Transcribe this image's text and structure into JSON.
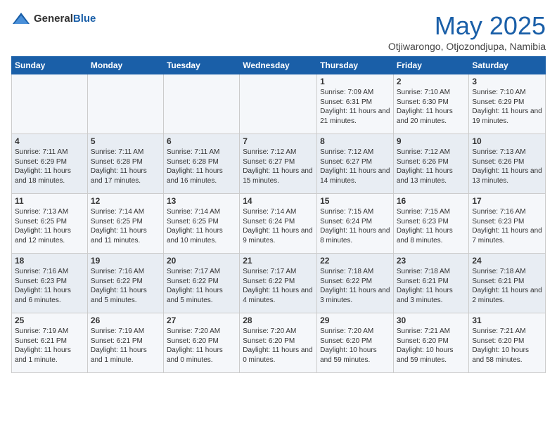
{
  "header": {
    "logo_general": "General",
    "logo_blue": "Blue",
    "month_title": "May 2025",
    "location": "Otjiwarongo, Otjozondjupa, Namibia"
  },
  "weekdays": [
    "Sunday",
    "Monday",
    "Tuesday",
    "Wednesday",
    "Thursday",
    "Friday",
    "Saturday"
  ],
  "weeks": [
    [
      {
        "day": "",
        "info": ""
      },
      {
        "day": "",
        "info": ""
      },
      {
        "day": "",
        "info": ""
      },
      {
        "day": "",
        "info": ""
      },
      {
        "day": "1",
        "info": "Sunrise: 7:09 AM\nSunset: 6:31 PM\nDaylight: 11 hours and 21 minutes."
      },
      {
        "day": "2",
        "info": "Sunrise: 7:10 AM\nSunset: 6:30 PM\nDaylight: 11 hours and 20 minutes."
      },
      {
        "day": "3",
        "info": "Sunrise: 7:10 AM\nSunset: 6:29 PM\nDaylight: 11 hours and 19 minutes."
      }
    ],
    [
      {
        "day": "4",
        "info": "Sunrise: 7:11 AM\nSunset: 6:29 PM\nDaylight: 11 hours and 18 minutes."
      },
      {
        "day": "5",
        "info": "Sunrise: 7:11 AM\nSunset: 6:28 PM\nDaylight: 11 hours and 17 minutes."
      },
      {
        "day": "6",
        "info": "Sunrise: 7:11 AM\nSunset: 6:28 PM\nDaylight: 11 hours and 16 minutes."
      },
      {
        "day": "7",
        "info": "Sunrise: 7:12 AM\nSunset: 6:27 PM\nDaylight: 11 hours and 15 minutes."
      },
      {
        "day": "8",
        "info": "Sunrise: 7:12 AM\nSunset: 6:27 PM\nDaylight: 11 hours and 14 minutes."
      },
      {
        "day": "9",
        "info": "Sunrise: 7:12 AM\nSunset: 6:26 PM\nDaylight: 11 hours and 13 minutes."
      },
      {
        "day": "10",
        "info": "Sunrise: 7:13 AM\nSunset: 6:26 PM\nDaylight: 11 hours and 13 minutes."
      }
    ],
    [
      {
        "day": "11",
        "info": "Sunrise: 7:13 AM\nSunset: 6:25 PM\nDaylight: 11 hours and 12 minutes."
      },
      {
        "day": "12",
        "info": "Sunrise: 7:14 AM\nSunset: 6:25 PM\nDaylight: 11 hours and 11 minutes."
      },
      {
        "day": "13",
        "info": "Sunrise: 7:14 AM\nSunset: 6:25 PM\nDaylight: 11 hours and 10 minutes."
      },
      {
        "day": "14",
        "info": "Sunrise: 7:14 AM\nSunset: 6:24 PM\nDaylight: 11 hours and 9 minutes."
      },
      {
        "day": "15",
        "info": "Sunrise: 7:15 AM\nSunset: 6:24 PM\nDaylight: 11 hours and 8 minutes."
      },
      {
        "day": "16",
        "info": "Sunrise: 7:15 AM\nSunset: 6:23 PM\nDaylight: 11 hours and 8 minutes."
      },
      {
        "day": "17",
        "info": "Sunrise: 7:16 AM\nSunset: 6:23 PM\nDaylight: 11 hours and 7 minutes."
      }
    ],
    [
      {
        "day": "18",
        "info": "Sunrise: 7:16 AM\nSunset: 6:23 PM\nDaylight: 11 hours and 6 minutes."
      },
      {
        "day": "19",
        "info": "Sunrise: 7:16 AM\nSunset: 6:22 PM\nDaylight: 11 hours and 5 minutes."
      },
      {
        "day": "20",
        "info": "Sunrise: 7:17 AM\nSunset: 6:22 PM\nDaylight: 11 hours and 5 minutes."
      },
      {
        "day": "21",
        "info": "Sunrise: 7:17 AM\nSunset: 6:22 PM\nDaylight: 11 hours and 4 minutes."
      },
      {
        "day": "22",
        "info": "Sunrise: 7:18 AM\nSunset: 6:22 PM\nDaylight: 11 hours and 3 minutes."
      },
      {
        "day": "23",
        "info": "Sunrise: 7:18 AM\nSunset: 6:21 PM\nDaylight: 11 hours and 3 minutes."
      },
      {
        "day": "24",
        "info": "Sunrise: 7:18 AM\nSunset: 6:21 PM\nDaylight: 11 hours and 2 minutes."
      }
    ],
    [
      {
        "day": "25",
        "info": "Sunrise: 7:19 AM\nSunset: 6:21 PM\nDaylight: 11 hours and 1 minute."
      },
      {
        "day": "26",
        "info": "Sunrise: 7:19 AM\nSunset: 6:21 PM\nDaylight: 11 hours and 1 minute."
      },
      {
        "day": "27",
        "info": "Sunrise: 7:20 AM\nSunset: 6:20 PM\nDaylight: 11 hours and 0 minutes."
      },
      {
        "day": "28",
        "info": "Sunrise: 7:20 AM\nSunset: 6:20 PM\nDaylight: 11 hours and 0 minutes."
      },
      {
        "day": "29",
        "info": "Sunrise: 7:20 AM\nSunset: 6:20 PM\nDaylight: 10 hours and 59 minutes."
      },
      {
        "day": "30",
        "info": "Sunrise: 7:21 AM\nSunset: 6:20 PM\nDaylight: 10 hours and 59 minutes."
      },
      {
        "day": "31",
        "info": "Sunrise: 7:21 AM\nSunset: 6:20 PM\nDaylight: 10 hours and 58 minutes."
      }
    ]
  ]
}
